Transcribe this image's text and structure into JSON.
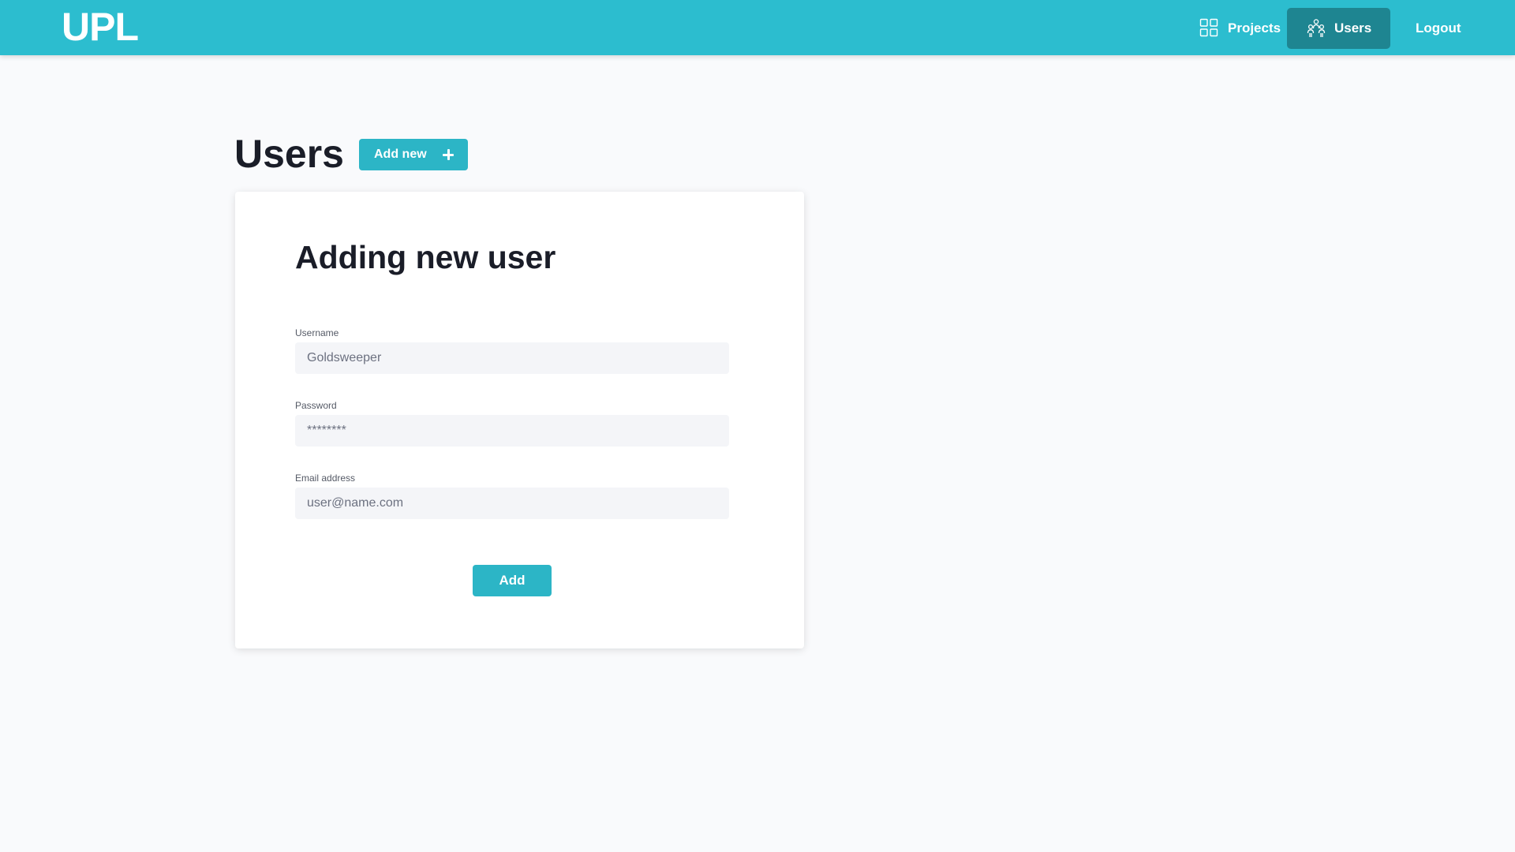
{
  "header": {
    "logo": "UPL",
    "nav": {
      "projects": {
        "label": "Projects",
        "icon": "grid-icon"
      },
      "users": {
        "label": "Users",
        "icon": "users-icon",
        "active": true
      },
      "logout": {
        "label": "Logout"
      }
    }
  },
  "page": {
    "title": "Users",
    "add_new_label": "Add new",
    "add_new_icon": "plus-icon"
  },
  "form": {
    "title": "Adding new user",
    "username": {
      "label": "Username",
      "placeholder": "Goldsweeper"
    },
    "password": {
      "label": "Password",
      "placeholder": "********"
    },
    "email": {
      "label": "Email address",
      "placeholder": "user@name.com"
    },
    "submit_label": "Add"
  },
  "colors": {
    "primary": "#2cbdcf",
    "button": "#2cb5c6",
    "active_nav": "#1e8591",
    "background": "#f9fafc",
    "input_bg": "#f4f5f8"
  }
}
